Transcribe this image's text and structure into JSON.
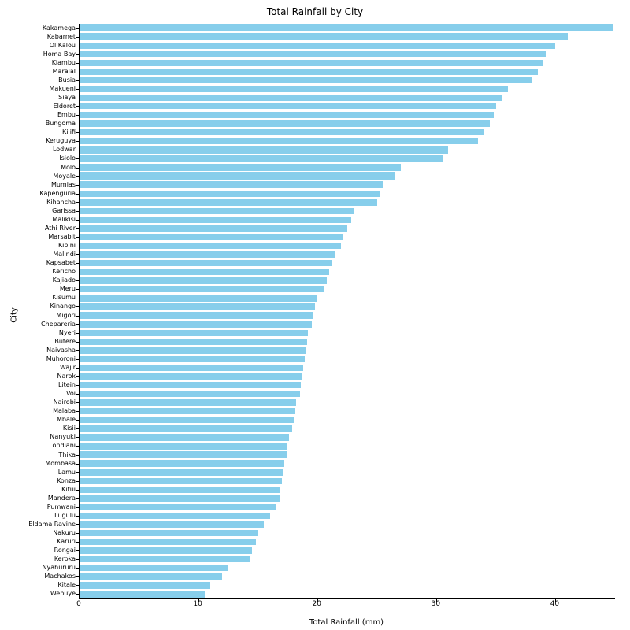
{
  "chart_data": {
    "type": "bar",
    "orientation": "horizontal",
    "title": "Total Rainfall by City",
    "xlabel": "Total Rainfall (mm)",
    "ylabel": "City",
    "xlim": [
      0,
      45
    ],
    "color": "#87CEEB",
    "categories": [
      "Kakamega",
      "Kabarnet",
      "Ol Kalou",
      "Homa Bay",
      "Kiambu",
      "Maralal",
      "Busia",
      "Makueni",
      "Siaya",
      "Eldoret",
      "Embu",
      "Bungoma",
      "Kilifi",
      "Keruguya",
      "Lodwar",
      "Isiolo",
      "Molo",
      "Moyale",
      "Mumias",
      "Kapenguria",
      "Kihancha",
      "Garissa",
      "Malikisi",
      "Athi River",
      "Marsabit",
      "Kipini",
      "Malindi",
      "Kapsabet",
      "Kericho",
      "Kajiado",
      "Meru",
      "Kisumu",
      "Kinango",
      "Migori",
      "Chepareria",
      "Nyeri",
      "Butere",
      "Naivasha",
      "Muhoroni",
      "Wajir",
      "Narok",
      "Litein",
      "Voi",
      "Nairobi",
      "Malaba",
      "Mbale",
      "Kisii",
      "Nanyuki",
      "Londiani",
      "Thika",
      "Mombasa",
      "Lamu",
      "Konza",
      "Kitui",
      "Mandera",
      "Pumwani",
      "Lugulu",
      "Eldama Ravine",
      "Nakuru",
      "Karuri",
      "Rongai",
      "Keroka",
      "Nyahururu",
      "Machakos",
      "Kitale",
      "Webuye"
    ],
    "values": [
      44.8,
      41.0,
      40.0,
      39.2,
      39.0,
      38.5,
      38.0,
      36.0,
      35.5,
      35.0,
      34.8,
      34.5,
      34.0,
      33.5,
      31.0,
      30.5,
      27.0,
      26.5,
      25.5,
      25.2,
      25.0,
      23.0,
      22.8,
      22.5,
      22.2,
      22.0,
      21.5,
      21.2,
      21.0,
      20.8,
      20.5,
      20.0,
      19.8,
      19.6,
      19.5,
      19.2,
      19.1,
      19.0,
      18.9,
      18.8,
      18.7,
      18.6,
      18.5,
      18.2,
      18.1,
      18.0,
      17.9,
      17.6,
      17.5,
      17.4,
      17.2,
      17.1,
      17.0,
      16.9,
      16.8,
      16.5,
      16.0,
      15.5,
      15.0,
      14.8,
      14.5,
      14.3,
      12.5,
      12.0,
      11.0,
      10.5
    ],
    "xticks": [
      0,
      10,
      20,
      30,
      40
    ]
  }
}
